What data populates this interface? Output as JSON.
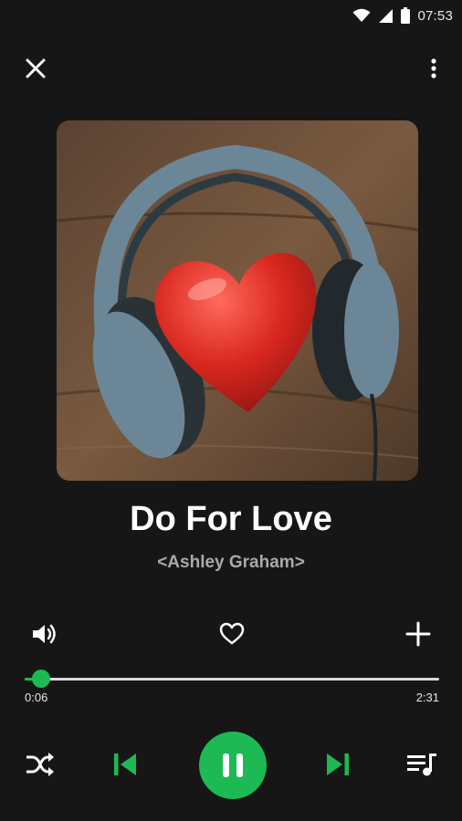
{
  "status_bar": {
    "time": "07:53",
    "icons": [
      "wifi-icon",
      "signal-icon",
      "battery-icon"
    ]
  },
  "header": {
    "close_icon": "close-icon",
    "menu_icon": "more-vertical-icon"
  },
  "track": {
    "title": "Do For Love",
    "artist": "<Ashley Graham>",
    "cover_art": "headphones-with-red-heart"
  },
  "actions": {
    "volume_icon": "volume-icon",
    "favorite_icon": "heart-outline-icon",
    "add_icon": "plus-icon"
  },
  "playback": {
    "elapsed": "0:06",
    "duration": "2:31",
    "progress_fraction": 0.04,
    "is_playing": true
  },
  "controls": {
    "shuffle_icon": "shuffle-icon",
    "previous_icon": "skip-previous-icon",
    "play_pause_icon": "pause-icon",
    "next_icon": "skip-next-icon",
    "queue_icon": "queue-music-icon"
  },
  "colors": {
    "accent": "#1db954",
    "background": "#161616",
    "text_primary": "#ffffff",
    "text_secondary": "#a9a9a9"
  }
}
